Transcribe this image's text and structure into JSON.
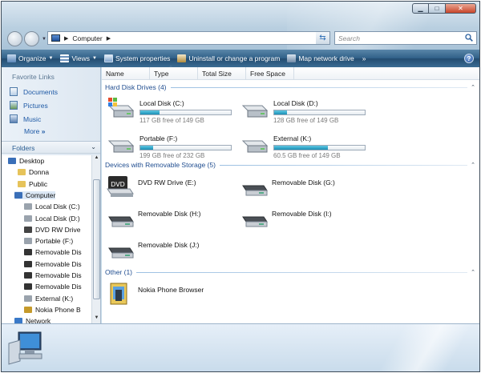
{
  "window": {
    "address_path": [
      "Computer"
    ],
    "search_placeholder": "Search"
  },
  "toolbar": {
    "organize": "Organize",
    "views": "Views",
    "system_properties": "System properties",
    "uninstall": "Uninstall or change a program",
    "map_drive": "Map network drive",
    "overflow": "»"
  },
  "sidebar": {
    "favorites_title": "Favorite Links",
    "favorites": [
      "Documents",
      "Pictures",
      "Music"
    ],
    "more": "More",
    "folders_title": "Folders",
    "tree": [
      {
        "label": "Desktop",
        "icon": "desktop-icon"
      },
      {
        "label": "Donna",
        "icon": "user-folder-icon"
      },
      {
        "label": "Public",
        "icon": "folder-icon"
      },
      {
        "label": "Computer",
        "icon": "computer-icon"
      },
      {
        "label": "Local Disk (C:)",
        "icon": "local-disk-icon"
      },
      {
        "label": "Local Disk (D:)",
        "icon": "local-disk-icon"
      },
      {
        "label": "DVD RW Drive",
        "icon": "dvd-icon"
      },
      {
        "label": "Portable (F:)",
        "icon": "local-disk-icon"
      },
      {
        "label": "Removable Dis",
        "icon": "removable-disk-icon"
      },
      {
        "label": "Removable Dis",
        "icon": "removable-disk-icon"
      },
      {
        "label": "Removable Dis",
        "icon": "removable-disk-icon"
      },
      {
        "label": "Removable Dis",
        "icon": "removable-disk-icon"
      },
      {
        "label": "External (K:)",
        "icon": "local-disk-icon"
      },
      {
        "label": "Nokia Phone B",
        "icon": "phone-icon"
      },
      {
        "label": "Network",
        "icon": "network-icon"
      }
    ]
  },
  "columns": [
    "Name",
    "Type",
    "Total Size",
    "Free Space"
  ],
  "groups": {
    "hard_disks": "Hard Disk Drives (4)",
    "removable": "Devices with Removable Storage (5)",
    "other": "Other (1)"
  },
  "hard_disks": [
    {
      "name": "Local Disk (C:)",
      "free": "117 GB free of 149 GB",
      "used_fraction": 0.21,
      "icon": "windows-disk-icon"
    },
    {
      "name": "Local Disk (D:)",
      "free": "128 GB free of 149 GB",
      "used_fraction": 0.14,
      "icon": "hard-disk-icon"
    },
    {
      "name": "Portable (F:)",
      "free": "199 GB free of 232 GB",
      "used_fraction": 0.14,
      "icon": "hard-disk-icon"
    },
    {
      "name": "External (K:)",
      "free": "60.5 GB free of 149 GB",
      "used_fraction": 0.59,
      "icon": "hard-disk-icon"
    }
  ],
  "removable": [
    {
      "name": "DVD RW Drive (E:)",
      "icon": "dvd-drive-icon"
    },
    {
      "name": "Removable Disk (G:)",
      "icon": "removable-disk-icon"
    },
    {
      "name": "Removable Disk (H:)",
      "icon": "removable-disk-icon"
    },
    {
      "name": "Removable Disk (I:)",
      "icon": "removable-disk-icon"
    },
    {
      "name": "Removable Disk (J:)",
      "icon": "removable-disk-icon"
    }
  ],
  "other": [
    {
      "name": "Nokia Phone Browser",
      "icon": "phone-browser-icon"
    }
  ],
  "colors": {
    "toolbar": "#2f5f87",
    "link": "#1f5aa6",
    "group_header": "#1e4c8f",
    "usage_bar": "#26a0c9"
  }
}
